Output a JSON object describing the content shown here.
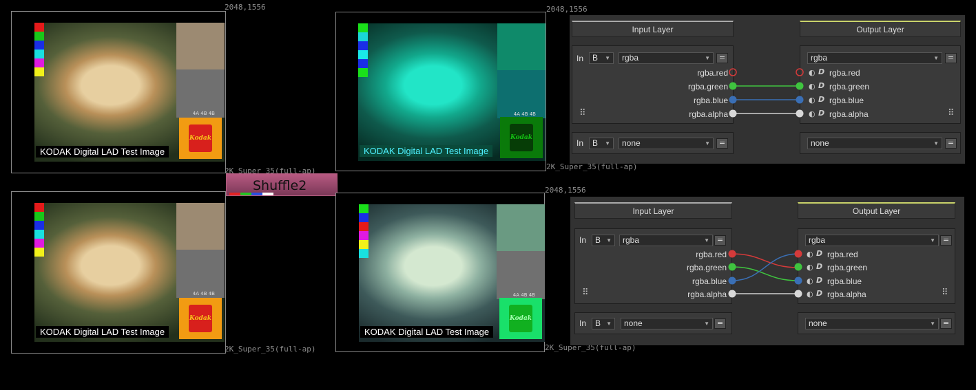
{
  "viewers": [
    {
      "id": "original-top",
      "resolution": "2048,1556",
      "format": "2K_Super_35(full-ap)",
      "caption": "KODAK Digital LAD Test Image",
      "logo": "Kodak"
    },
    {
      "id": "shuffled-top",
      "resolution": "2048,1556",
      "format": "2K_Super_35(full-ap)",
      "caption": "KODAK Digital LAD Test Image",
      "logo": "Kodak"
    },
    {
      "id": "original-bottom",
      "format": "2K_Super_35(full-ap)",
      "caption": "KODAK Digital LAD Test Image",
      "logo": "Kodak"
    },
    {
      "id": "shuffled-bottom",
      "resolution": "2048,1556",
      "format": "2K_Super_35(full-ap)",
      "caption": "KODAK Digital LAD Test Image",
      "logo": "Kodak"
    }
  ],
  "tiny_text": "4A 4B 4B",
  "node": {
    "label": "Shuffle2",
    "chip_colors": [
      "#e32323",
      "#22c422",
      "#2a4fe0",
      "#ffffff"
    ]
  },
  "shuffle_panels": [
    {
      "input_header": "Input Layer",
      "output_header": "Output Layer",
      "in_label": "In",
      "in_value": "B",
      "input_layer": "rgba",
      "output_layer": "rgba",
      "in_label_2": "In",
      "in_value_2": "B",
      "input_layer_2": "none",
      "output_layer_2": "none",
      "in_channels": [
        "rgba.red",
        "rgba.green",
        "rgba.blue",
        "rgba.alpha"
      ],
      "out_channels": [
        "rgba.red",
        "rgba.green",
        "rgba.blue",
        "rgba.alpha"
      ],
      "mapping": "red unconnected; green→green; blue→blue; alpha→alpha"
    },
    {
      "input_header": "Input Layer",
      "output_header": "Output Layer",
      "in_label": "In",
      "in_value": "B",
      "input_layer": "rgba",
      "output_layer": "rgba",
      "in_label_2": "In",
      "in_value_2": "B",
      "input_layer_2": "none",
      "output_layer_2": "none",
      "in_channels": [
        "rgba.red",
        "rgba.green",
        "rgba.blue",
        "rgba.alpha"
      ],
      "out_channels": [
        "rgba.red",
        "rgba.green",
        "rgba.blue",
        "rgba.alpha"
      ],
      "mapping": "red→green; green→blue; blue→red; alpha→alpha"
    }
  ],
  "channel_colors": {
    "red": "#d43a3a",
    "green": "#3fc43f",
    "blue": "#3a6fb5",
    "alpha": "#d8d8d8"
  },
  "icons": [
    "grip-icon",
    "mask-toggle-icon",
    "disable-toggle-icon",
    "dropdown-arrow-icon"
  ]
}
